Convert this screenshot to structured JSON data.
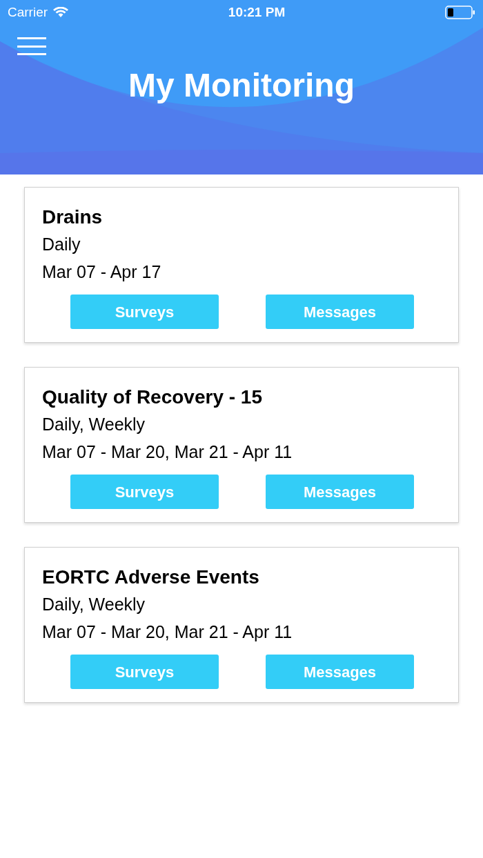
{
  "status_bar": {
    "carrier": "Carrier",
    "time": "10:21 PM"
  },
  "header": {
    "title": "My Monitoring"
  },
  "cards": [
    {
      "title": "Drains",
      "frequency": "Daily",
      "dates": "Mar 07 - Apr 17",
      "buttons": [
        "Surveys",
        "Messages"
      ]
    },
    {
      "title": "Quality of Recovery - 15",
      "frequency": "Daily, Weekly",
      "dates": "Mar 07 - Mar 20, Mar 21 - Apr 11",
      "buttons": [
        "Surveys",
        "Messages"
      ]
    },
    {
      "title": "EORTC Adverse Events",
      "frequency": "Daily, Weekly",
      "dates": "Mar 07 - Mar 20, Mar 21 - Apr 11",
      "buttons": [
        "Surveys",
        "Messages"
      ]
    }
  ]
}
